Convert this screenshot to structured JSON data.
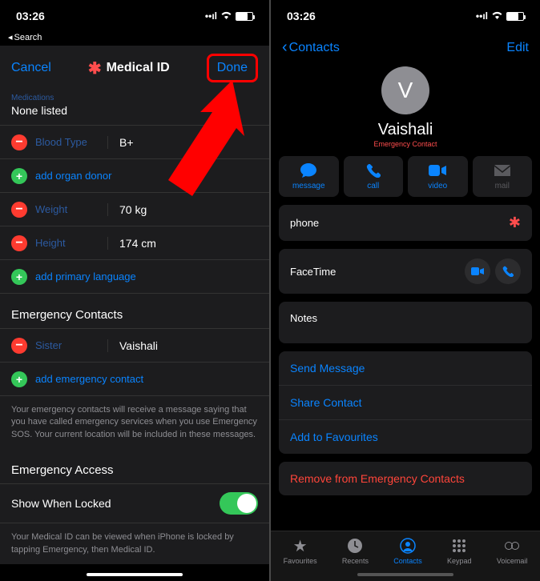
{
  "status": {
    "time": "03:26"
  },
  "left": {
    "back_search": "Search",
    "cancel": "Cancel",
    "title": "Medical ID",
    "done": "Done",
    "medications_label": "Medications",
    "none_listed": "None listed",
    "blood_type_label": "Blood Type",
    "blood_type_value": "B+",
    "add_organ_donor": "add organ donor",
    "weight_label": "Weight",
    "weight_value": "70 kg",
    "height_label": "Height",
    "height_value": "174 cm",
    "add_primary_language": "add primary language",
    "emergency_contacts_title": "Emergency Contacts",
    "sister_label": "Sister",
    "sister_value": "Vaishali",
    "add_emergency_contact": "add emergency contact",
    "emergency_footer": "Your emergency contacts will receive a message saying that you have called emergency services when you use Emergency SOS. Your current location will be included in these messages.",
    "emergency_access_title": "Emergency Access",
    "show_when_locked": "Show When Locked",
    "locked_footer": "Your Medical ID can be viewed when iPhone is locked by tapping Emergency, then Medical ID."
  },
  "right": {
    "back": "Contacts",
    "edit": "Edit",
    "avatar_initial": "V",
    "name": "Vaishali",
    "subtitle": "Emergency Contact",
    "actions": {
      "message": "message",
      "call": "call",
      "video": "video",
      "mail": "mail"
    },
    "phone_label": "phone",
    "facetime_label": "FaceTime",
    "notes_label": "Notes",
    "send_message": "Send Message",
    "share_contact": "Share Contact",
    "add_favourites": "Add to Favourites",
    "remove_emergency": "Remove from Emergency Contacts",
    "tabs": {
      "favourites": "Favourites",
      "recents": "Recents",
      "contacts": "Contacts",
      "keypad": "Keypad",
      "voicemail": "Voicemail"
    }
  }
}
